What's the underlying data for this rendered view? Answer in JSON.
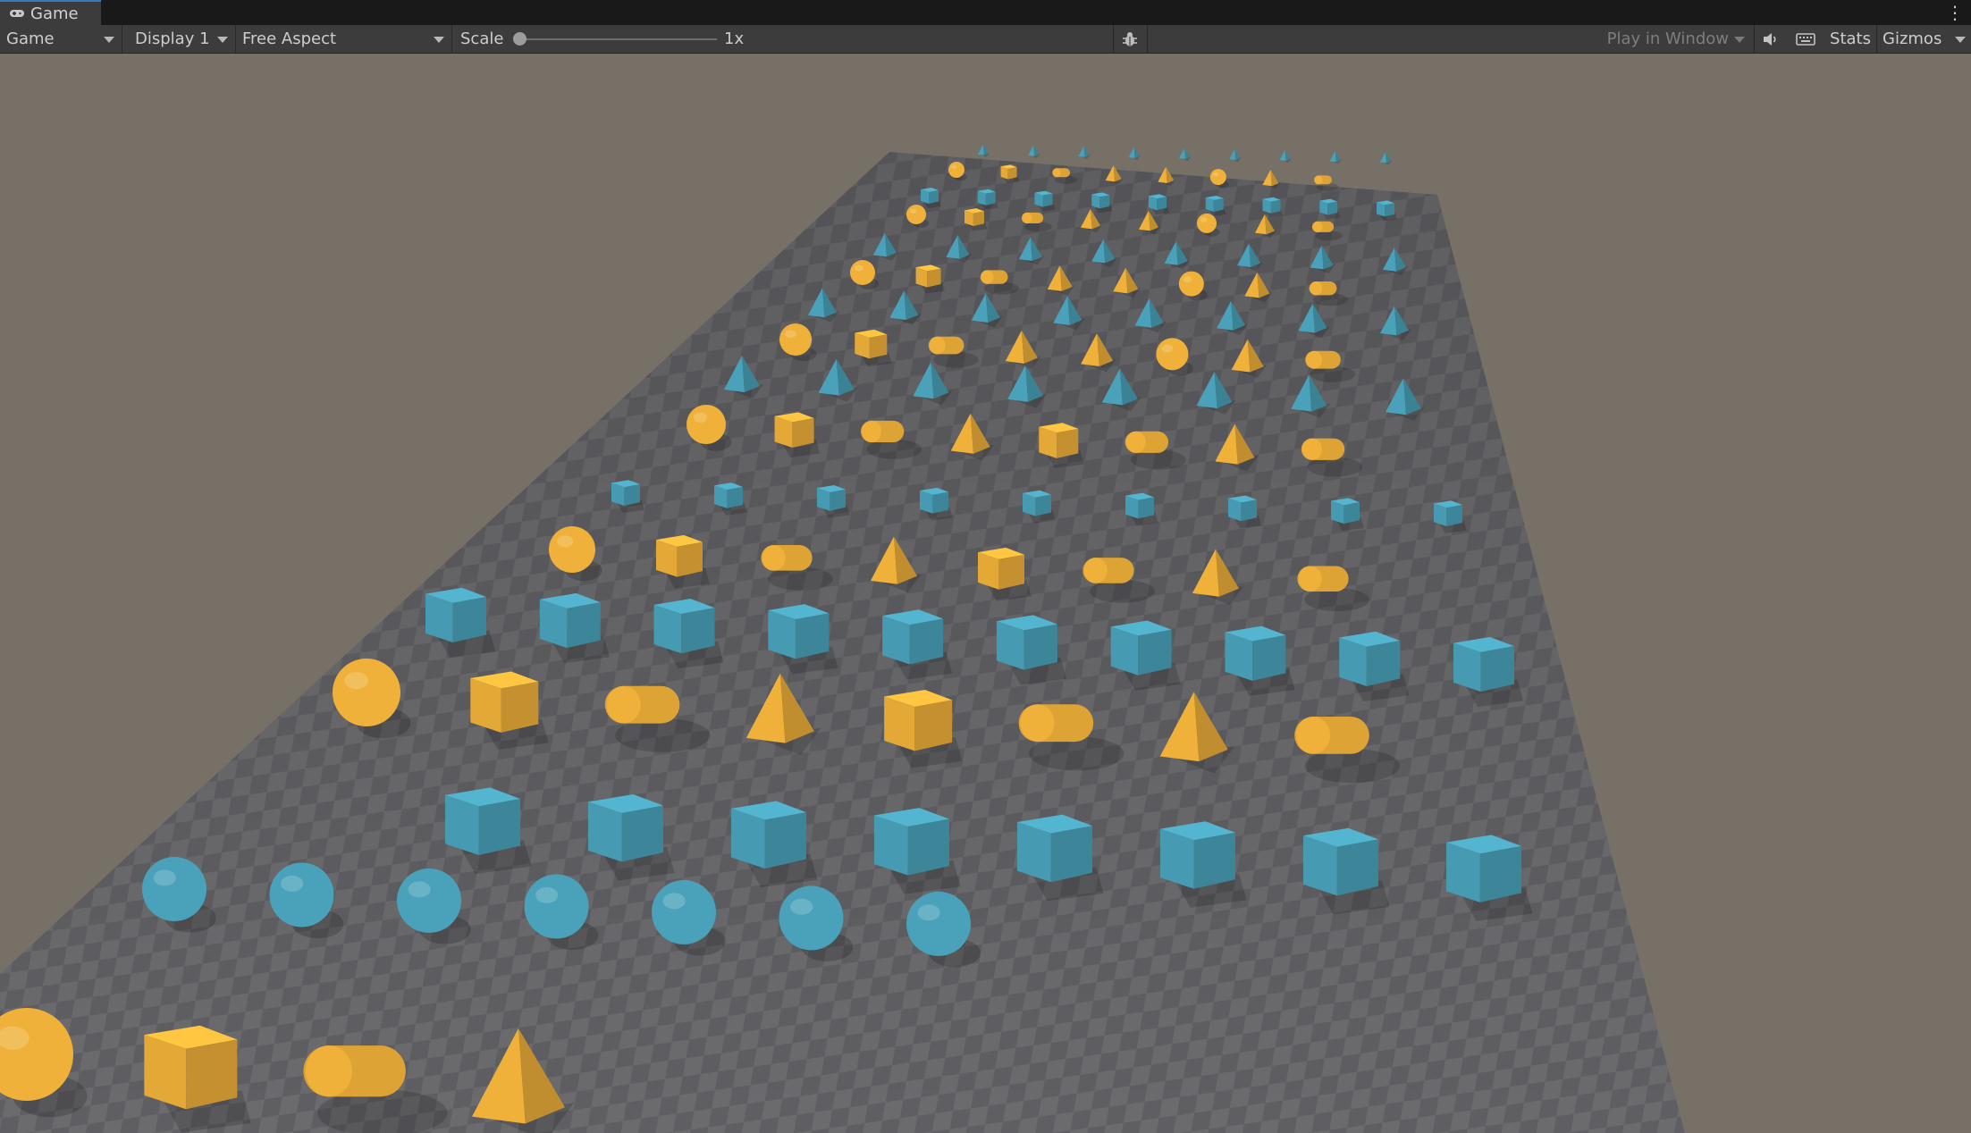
{
  "window": {
    "tab_label": "Game",
    "tab_icon": "gamepad-icon"
  },
  "toolbar": {
    "view_mode": "Game",
    "display": "Display 1",
    "aspect": "Free Aspect",
    "scale_label": "Scale",
    "scale_value": "1x",
    "scale_fraction": 0.0,
    "play_mode": "Play in Window",
    "stats_label": "Stats",
    "gizmos_label": "Gizmos",
    "bug_icon": "bug-icon",
    "audio_icon": "speaker-icon",
    "keyboard_icon": "keyboard-icon",
    "more_icon": "kebab-menu-icon"
  },
  "scene": {
    "background_color": "#767067",
    "floor_color": "#6b6b6e",
    "floor_checker_color": "#606064",
    "gold_color": "#f0b13a",
    "teal_color": "#4aa2ba"
  }
}
